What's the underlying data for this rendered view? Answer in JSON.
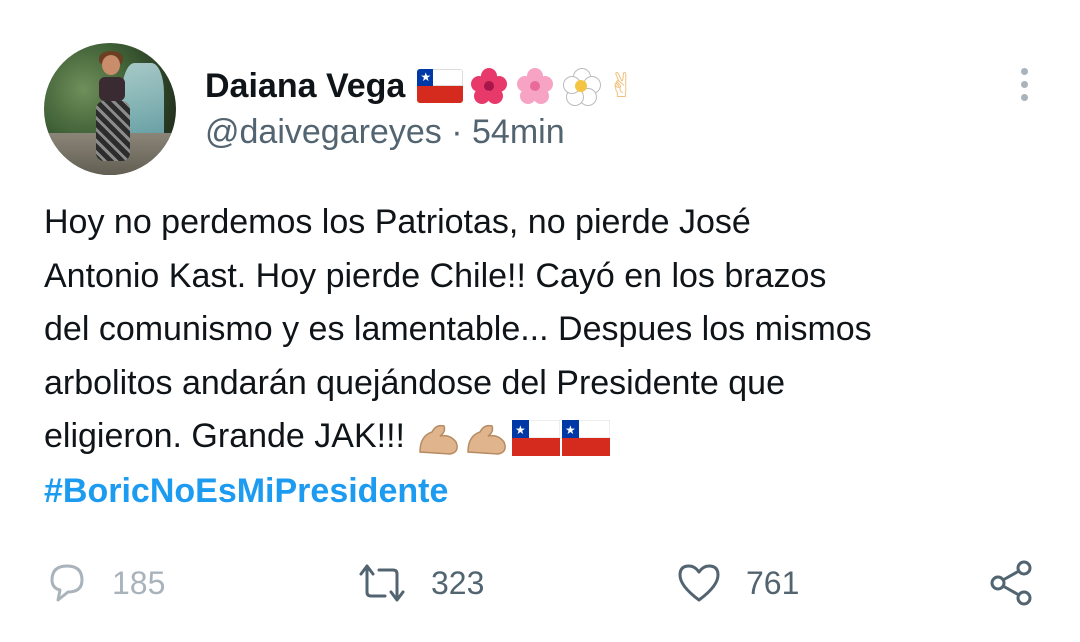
{
  "tweet": {
    "display_name": "Daiana Vega",
    "name_emojis": [
      "🇨🇱",
      "🌺",
      "🌸",
      "🌼",
      "✌🏻"
    ],
    "handle": "@daivegareyes",
    "separator": "·",
    "time": "54min",
    "text_lines": [
      "Hoy no perdemos los Patriotas, no pierde José",
      "Antonio Kast. Hoy pierde Chile!! Cayó en los brazos",
      "del comunismo y es lamentable... Despues los mismos",
      "arbolitos andarán quejándose del Presidente que",
      "eligieron. Grande JAK!!!"
    ],
    "text_emojis": [
      "💪🏼",
      "💪🏼",
      "🇨🇱",
      "🇨🇱"
    ],
    "hashtag": "#BoricNoEsMiPresidente"
  },
  "actions": {
    "replies": "185",
    "retweets": "323",
    "likes": "761"
  },
  "icons": {
    "more": "more-vertical-icon",
    "reply": "reply-icon",
    "retweet": "retweet-icon",
    "like": "heart-icon",
    "share": "share-icon"
  },
  "colors": {
    "link": "#1d9bf0",
    "secondary_text": "#536471",
    "primary_text": "#0f1419"
  }
}
